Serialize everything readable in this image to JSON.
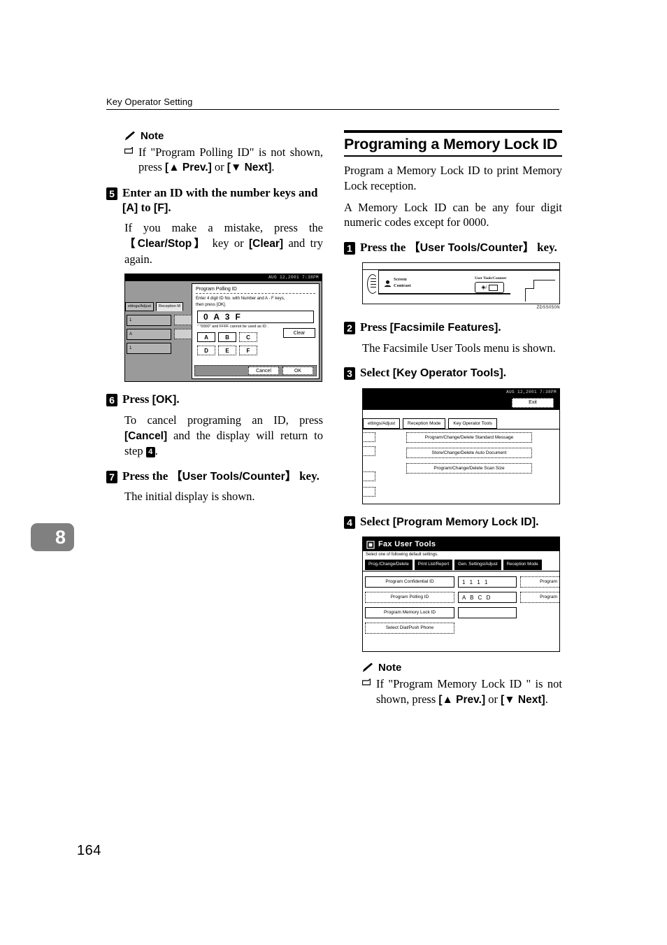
{
  "page": {
    "running_header": "Key Operator Setting",
    "chapter_tab": "8",
    "folio": "164"
  },
  "left_column": {
    "note": {
      "heading": "Note",
      "items": [
        {
          "text_1": "If \"Program Polling ID\" is not shown, press ",
          "key_1": "[▲ Prev.]",
          "text_2": " or ",
          "key_2": "[▼ Next]",
          "text_3": "."
        }
      ]
    },
    "steps": [
      {
        "num": "5",
        "title_plain_1": "Enter an ID with the number keys and ",
        "title_bkt_1": "[A]",
        "title_plain_2": " to ",
        "title_bkt_2": "[F]",
        "title_plain_3": ".",
        "body_1": "If you make a mistake, press the ",
        "body_key_1": "【Clear/Stop】",
        "body_2": " key or ",
        "body_key_2": "[Clear]",
        "body_3": " and try again."
      },
      {
        "num": "6",
        "title_plain_1": "Press ",
        "title_bkt_1": "[OK]",
        "title_plain_2": ".",
        "body_1": "To cancel programing an ID, press ",
        "body_key_1": "[Cancel]",
        "body_2": " and the display will return to step ",
        "body_step_ref": "4",
        "body_3": "."
      },
      {
        "num": "7",
        "title_plain_1": "Press the ",
        "title_bkt_1": "【User Tools/Counter】",
        "title_plain_2": " key.",
        "body_1": "The initial display is shown."
      }
    ],
    "screen_polling_id": {
      "status_bar": "AUG  12,2001   7:38PM",
      "tabs": [
        {
          "label": "ettings/Adjust",
          "selected": false
        },
        {
          "label": "Reception M",
          "selected": true
        }
      ],
      "left_buttons": [
        "1",
        "A",
        "1"
      ],
      "dialog": {
        "title": "Program Polling ID",
        "instruction_line_1": "Enter 4 digit ID No. with Number and A - F keys,",
        "instruction_line_2": "then press [OK].",
        "entry_value": "0 A 3 F",
        "warning": "\" \"0000\" and FFFF cannot be used as ID .",
        "keys_row_1": [
          "A",
          "B",
          "C"
        ],
        "keys_row_2": [
          "D",
          "E",
          "F"
        ],
        "clear_label": "Clear",
        "cancel_label": "Cancel",
        "ok_label": "OK"
      }
    }
  },
  "right_column": {
    "section": {
      "title": "Programing a Memory Lock ID",
      "intro_1": "Program a Memory Lock ID to print Memory Lock reception.",
      "intro_2": "A Memory Lock ID can be any four digit numeric codes except for 0000."
    },
    "steps": [
      {
        "num": "1",
        "title_plain_1": "Press the ",
        "title_bkt_1": "【User Tools/Counter】",
        "title_plain_2": " key."
      },
      {
        "num": "2",
        "title_plain_1": "Press ",
        "title_bkt_1": "[Facsimile Features]",
        "title_plain_2": ".",
        "body_1": "The Facsimile User Tools menu is shown."
      },
      {
        "num": "3",
        "title_plain_1": "Select ",
        "title_bkt_1": "[Key Operator Tools]",
        "title_plain_2": "."
      },
      {
        "num": "4",
        "title_plain_1": "Select ",
        "title_bkt_1": "[Program Memory Lock ID]",
        "title_plain_2": "."
      }
    ],
    "panel_photo": {
      "screen_contrast_label_1": "Screen",
      "screen_contrast_label_2": "Contrast",
      "user_tools_counter_label": "User Tools/Counter",
      "caption": "ZDSS050N"
    },
    "screen_key_operator_tools": {
      "status_bar": "AUG  12,2001   7:38PM",
      "exit_label": "Exit",
      "tabs": [
        {
          "label": "ettings/Adjust",
          "selected": true
        },
        {
          "label": "Reception Mode",
          "selected": true
        },
        {
          "label": "Key Operator Tools",
          "selected": true
        }
      ],
      "menu_buttons": [
        "Program/Change/Delete Standard Message",
        "Store/Change/Delete Auto Document",
        "Program/Change/Delete Scan Size"
      ]
    },
    "screen_fax_user_tools": {
      "title": "Fax User Tools",
      "subtitle": "Select one of following default settings.",
      "tabs": [
        "Prog./Change/Delete",
        "Print List/Report",
        "Gen. Settings/Adjust",
        "Reception Mode"
      ],
      "rows": [
        {
          "label": "Program Confidential ID",
          "value": "1 1 1 1",
          "right_label": "Program"
        },
        {
          "label": "Program Polling ID",
          "value": "A B C D",
          "right_label": "Program"
        },
        {
          "label": "Program Memory Lock ID",
          "value": "",
          "right_label": ""
        },
        {
          "label": "Select Dial/Push Phone",
          "value": "",
          "right_label": ""
        }
      ]
    },
    "note": {
      "heading": "Note",
      "items": [
        {
          "text_1": "If \"Program Memory Lock ID \" is not shown, press ",
          "key_1": "[▲ Prev.]",
          "text_2": " or ",
          "key_2": "[▼ Next]",
          "text_3": "."
        }
      ]
    }
  }
}
